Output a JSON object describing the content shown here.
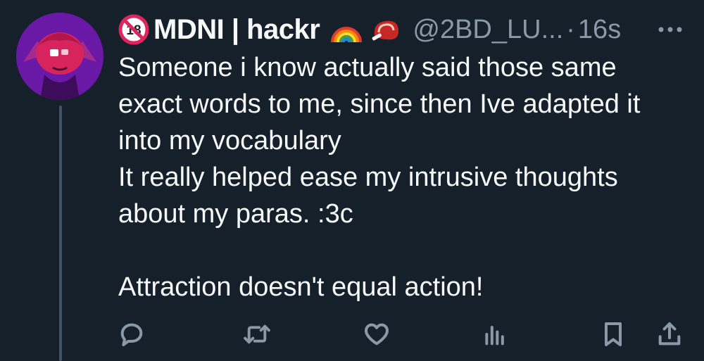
{
  "tweet": {
    "display_name": "MDNI | hackr",
    "handle": "@2BD_LU...",
    "separator": "·",
    "time": "16s",
    "badge_icon": "no-under-18-icon",
    "emoji_icons": [
      "rainbow-icon",
      "meat-icon"
    ],
    "text_lines": [
      "Someone i know actually said those same",
      "exact words to me, since then Ive adapted it",
      "into my vocabulary",
      "It really helped ease my intrusive thoughts",
      "about my paras. :3c",
      "",
      "Attraction doesn't equal action!"
    ]
  },
  "actions": [
    {
      "icon": "reply-icon"
    },
    {
      "icon": "retweet-icon"
    },
    {
      "icon": "like-icon"
    },
    {
      "icon": "views-icon"
    },
    {
      "icon": "bookmark-icon"
    },
    {
      "icon": "share-icon"
    }
  ],
  "colors": {
    "background": "#15202b",
    "text": "#f7f9f9",
    "muted": "#8b98a5",
    "thread_line": "#425364"
  }
}
